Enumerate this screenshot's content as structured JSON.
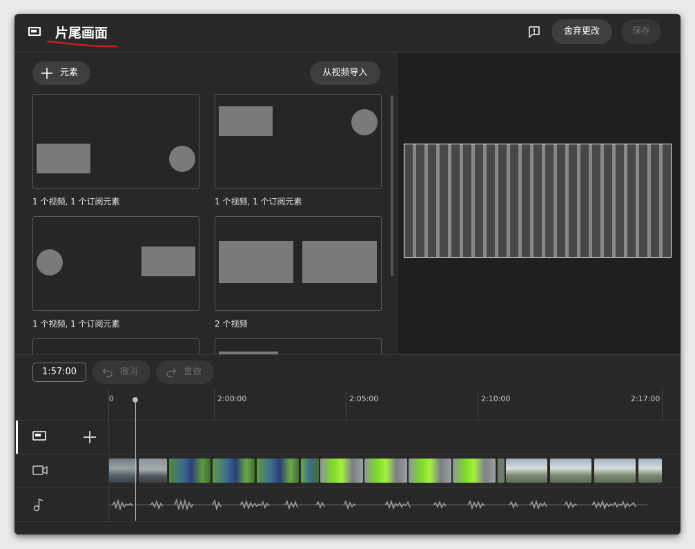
{
  "header": {
    "title": "片尾画面",
    "discard_label": "舍弃更改",
    "save_label": "保存"
  },
  "toolbar": {
    "add_element_label": "元素",
    "import_label": "从视频导入"
  },
  "templates": [
    {
      "caption": "1 个视频, 1 个订阅元素"
    },
    {
      "caption": "1 个视频, 1 个订阅元素"
    },
    {
      "caption": "1 个视频, 1 个订阅元素"
    },
    {
      "caption": "2 个视频"
    }
  ],
  "timeline": {
    "current_time": "1:57:00",
    "undo_label": "撤消",
    "redo_label": "重做",
    "ticks": [
      "0",
      "2:00:00",
      "2:05:00",
      "2:10:00",
      "2:17:00"
    ]
  },
  "icons": {
    "endscreen": "endscreen-icon",
    "feedback": "feedback-icon",
    "add": "plus-icon",
    "undo": "undo-icon",
    "redo": "redo-icon",
    "video": "video-camera-icon",
    "audio": "music-note-icon"
  },
  "colors": {
    "background": "#282828",
    "button": "#3e3e3e",
    "disabled_text": "#6f6f6f",
    "placeholder": "#7a7a7a"
  }
}
